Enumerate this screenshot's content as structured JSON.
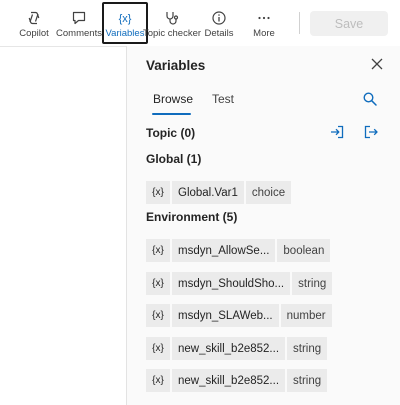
{
  "toolbar": {
    "items": [
      {
        "label": "Copilot",
        "icon": "copilot-icon"
      },
      {
        "label": "Comments",
        "icon": "comment-icon"
      },
      {
        "label": "Variables",
        "icon": "variables-icon",
        "active": true
      },
      {
        "label": "Topic checker",
        "icon": "stethoscope-icon"
      },
      {
        "label": "Details",
        "icon": "info-icon"
      },
      {
        "label": "More",
        "icon": "more-icon"
      }
    ],
    "save_label": "Save"
  },
  "panel": {
    "title": "Variables",
    "tabs": [
      {
        "label": "Browse",
        "selected": true
      },
      {
        "label": "Test",
        "selected": false
      }
    ],
    "sections": {
      "topic": "Topic (0)",
      "global": "Global (1)",
      "environment": "Environment (5)"
    },
    "variable_icon_text": "{x}",
    "global_vars": [
      {
        "name": "Global.Var1",
        "type": "choice"
      }
    ],
    "env_vars": [
      {
        "name": "msdyn_AllowSe...",
        "type": "boolean"
      },
      {
        "name": "msdyn_ShouldSho...",
        "type": "string"
      },
      {
        "name": "msdyn_SLAWeb...",
        "type": "number"
      },
      {
        "name": "new_skill_b2e852...",
        "type": "string"
      },
      {
        "name": "new_skill_b2e852...",
        "type": "string"
      }
    ]
  },
  "colors": {
    "accent": "#0f6cbd",
    "chip_bg": "#ebebeb",
    "panel_bg": "#fafafa"
  }
}
